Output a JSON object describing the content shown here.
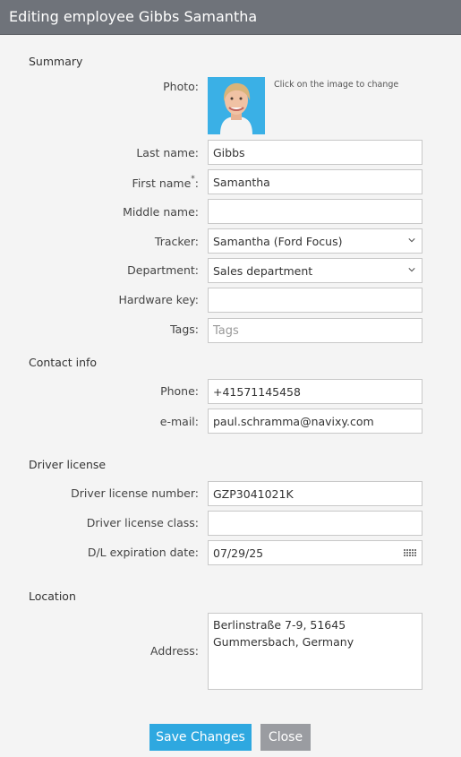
{
  "dialog": {
    "title": "Editing employee Gibbs Samantha"
  },
  "summary": {
    "heading": "Summary",
    "photo_label": "Photo:",
    "photo_hint": "Click on the image to change",
    "last_name_label": "Last name:",
    "last_name_value": "Gibbs",
    "first_name_label": "First name",
    "first_name_required_mark": "*",
    "first_name_colon": ":",
    "first_name_value": "Samantha",
    "middle_name_label": "Middle name:",
    "middle_name_value": "",
    "tracker_label": "Tracker:",
    "tracker_value": "Samantha (Ford Focus)",
    "department_label": "Department:",
    "department_value": "Sales department",
    "hardware_key_label": "Hardware key:",
    "hardware_key_value": "",
    "tags_label": "Tags:",
    "tags_placeholder": "Tags"
  },
  "contact": {
    "heading": "Contact info",
    "phone_label": "Phone:",
    "phone_value": "+41571145458",
    "email_label": "e-mail:",
    "email_value": "paul.schramma@navixy.com"
  },
  "license": {
    "heading": "Driver license",
    "number_label": "Driver license number:",
    "number_value": "GZP3041021K",
    "class_label": "Driver license class:",
    "class_value": "",
    "expiration_label": "D/L expiration date:",
    "expiration_value": "07/29/25"
  },
  "location": {
    "heading": "Location",
    "address_label": "Address:",
    "address_line1": "Berlinstraße 7-9, 51645",
    "address_line2": "Gummersbach, Germany"
  },
  "buttons": {
    "save": "Save Changes",
    "close": "Close"
  },
  "icons": {
    "select_arrow": "chevron-down-icon",
    "calendar": "calendar-icon"
  },
  "colors": {
    "titlebar": "#6f737a",
    "save_button": "#2ea8e0",
    "close_button": "#9a9ca1"
  }
}
